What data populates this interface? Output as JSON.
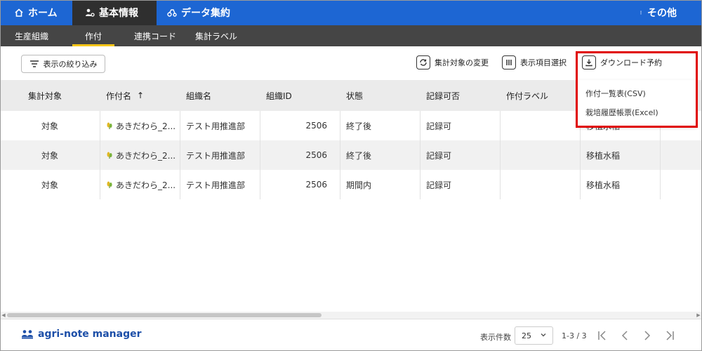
{
  "topnav": {
    "home": "ホーム",
    "basic_info": "基本情報",
    "data_aggregation": "データ集約",
    "more": "その他"
  },
  "subtabs": [
    "生産組織",
    "作付",
    "連携コード",
    "集計ラベル"
  ],
  "toolbar": {
    "filter": "表示の絞り込み",
    "change_target": "集計対象の変更",
    "select_columns": "表示項目選択",
    "download": "ダウンロード予約"
  },
  "download_menu": [
    "作付一覧表(CSV)",
    "栽培履歴帳票(Excel)"
  ],
  "table": {
    "headers": [
      "集計対象",
      "作付名",
      "組織名",
      "組織ID",
      "状態",
      "記録可否",
      "作付ラベル"
    ],
    "sort_indicator": "↑",
    "rows": [
      {
        "target": "対象",
        "name": "あきだわら_2...",
        "org": "テスト用推進部",
        "org_id": "2506",
        "status": "終了後",
        "record": "記録可",
        "label": "",
        "crop": "移植水稲"
      },
      {
        "target": "対象",
        "name": "あきだわら_2...",
        "org": "テスト用推進部",
        "org_id": "2506",
        "status": "終了後",
        "record": "記録可",
        "label": "",
        "crop": "移植水稲"
      },
      {
        "target": "対象",
        "name": "あきだわら_2...",
        "org": "テスト用推進部",
        "org_id": "2506",
        "status": "期間内",
        "record": "記録可",
        "label": "",
        "crop": "移植水稲"
      }
    ]
  },
  "footer": {
    "brand": "agri-note manager",
    "per_page_label": "表示件数",
    "per_page_value": "25",
    "range": "1-3 / 3"
  },
  "colors": {
    "topbar": "#1d66d3",
    "active_nav": "#2f2f2f",
    "subbar": "#454545",
    "tab_indicator": "#f5c518",
    "highlight": "#e00000"
  }
}
